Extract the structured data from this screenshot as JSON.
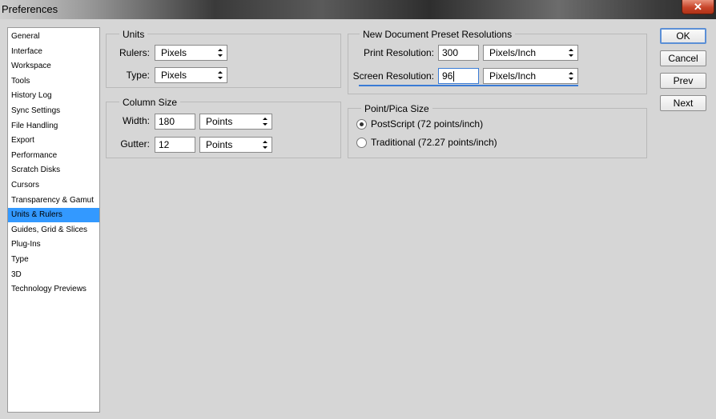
{
  "window": {
    "title": "Preferences",
    "close_glyph": "✕"
  },
  "sidebar": {
    "items": [
      {
        "label": "General"
      },
      {
        "label": "Interface"
      },
      {
        "label": "Workspace"
      },
      {
        "label": "Tools"
      },
      {
        "label": "History Log"
      },
      {
        "label": "Sync Settings"
      },
      {
        "label": "File Handling"
      },
      {
        "label": "Export"
      },
      {
        "label": "Performance"
      },
      {
        "label": "Scratch Disks"
      },
      {
        "label": "Cursors"
      },
      {
        "label": "Transparency & Gamut"
      },
      {
        "label": "Units & Rulers"
      },
      {
        "label": "Guides, Grid & Slices"
      },
      {
        "label": "Plug-Ins"
      },
      {
        "label": "Type"
      },
      {
        "label": "3D"
      },
      {
        "label": "Technology Previews"
      }
    ],
    "selected": "Units & Rulers"
  },
  "units": {
    "title": "Units",
    "rulers_label": "Rulers:",
    "rulers_value": "Pixels",
    "type_label": "Type:",
    "type_value": "Pixels"
  },
  "column_size": {
    "title": "Column Size",
    "width_label": "Width:",
    "width_value": "180",
    "width_unit": "Points",
    "gutter_label": "Gutter:",
    "gutter_value": "12",
    "gutter_unit": "Points"
  },
  "preset_resolutions": {
    "title": "New Document Preset Resolutions",
    "print_label": "Print Resolution:",
    "print_value": "300",
    "print_unit": "Pixels/Inch",
    "screen_label": "Screen Resolution:",
    "screen_value": "96",
    "screen_unit": "Pixels/Inch"
  },
  "point_pica": {
    "title": "Point/Pica Size",
    "options": [
      {
        "label": "PostScript (72 points/inch)",
        "checked": true
      },
      {
        "label": "Traditional (72.27 points/inch)",
        "checked": false
      }
    ]
  },
  "buttons": {
    "ok": "OK",
    "cancel": "Cancel",
    "prev": "Prev",
    "next": "Next"
  },
  "icons": {
    "dropdown": "up-down-arrows-icon",
    "close": "close-icon"
  }
}
